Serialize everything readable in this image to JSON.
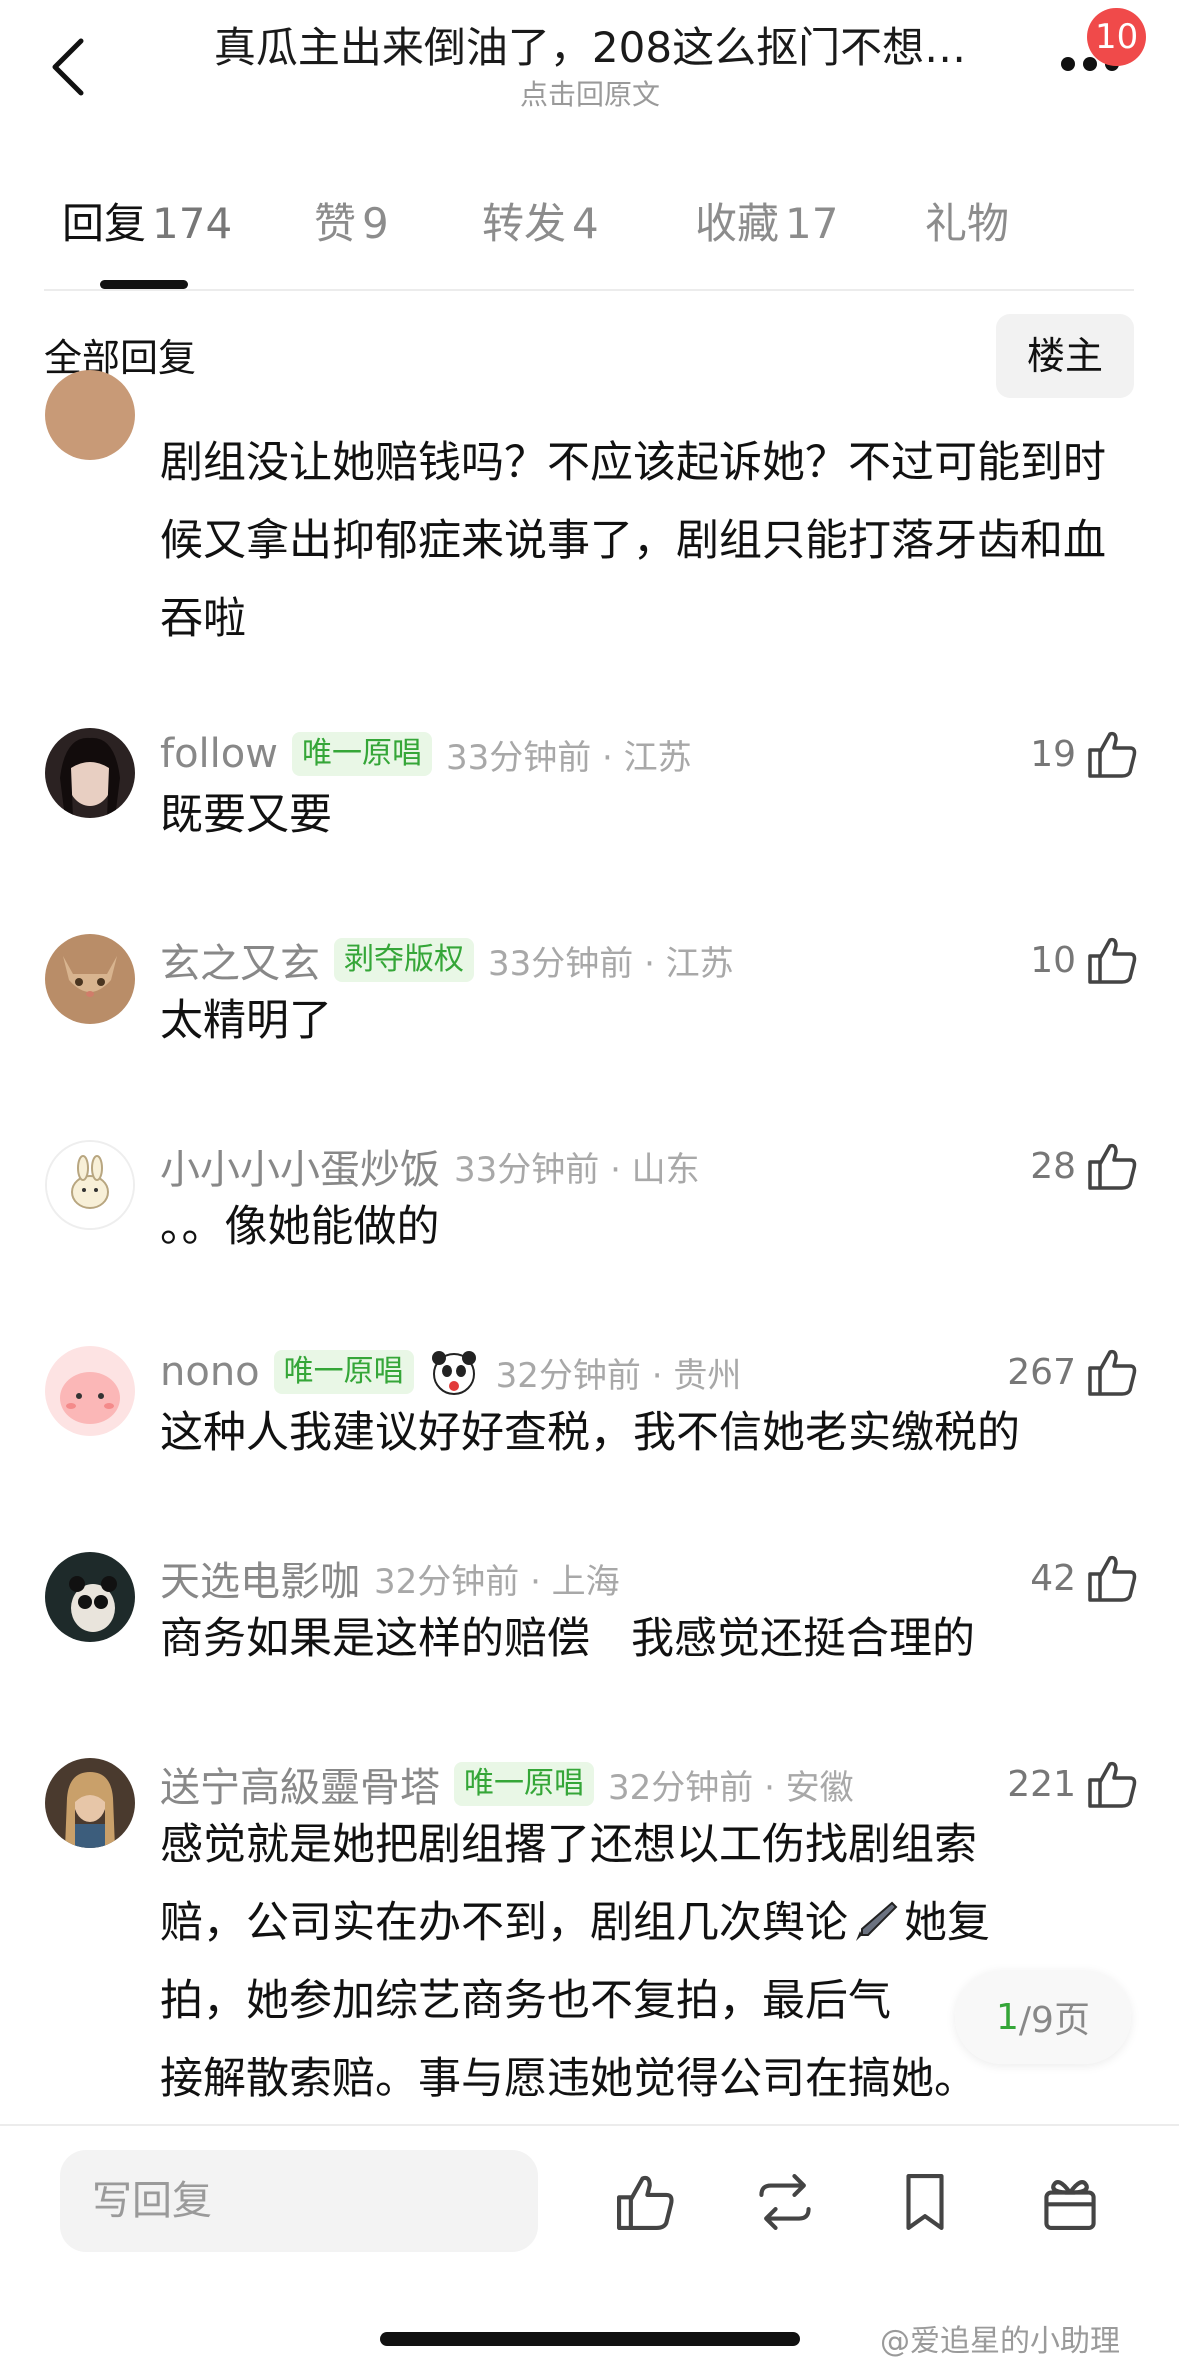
{
  "header": {
    "title": "真瓜主出来倒油了，208这么抠门不想…",
    "subtitle": "点击回原文",
    "notification_count": "10"
  },
  "tabs": [
    {
      "label": "回复",
      "count": "174",
      "active": true
    },
    {
      "label": "赞",
      "count": "9"
    },
    {
      "label": "转发",
      "count": "4"
    },
    {
      "label": "收藏",
      "count": "17"
    },
    {
      "label": "礼物",
      "count": ""
    }
  ],
  "filter": {
    "label": "全部回复",
    "host_button": "楼主"
  },
  "comments": [
    {
      "name": "",
      "badge": "",
      "time": "",
      "likes": "",
      "text": "剧组没让她赔钱吗？不应该起诉她？不过可能到时候又拿出抑郁症来说事了，剧组只能打落牙齿和血吞啦"
    },
    {
      "name": "follow",
      "badge": "唯一原唱",
      "time": "33分钟前 · 江苏",
      "likes": "19",
      "text": "既要又要"
    },
    {
      "name": "玄之又玄",
      "badge": "剥夺版权",
      "time": "33分钟前 · 江苏",
      "likes": "10",
      "text": "太精明了"
    },
    {
      "name": "小小小小蛋炒饭",
      "badge": "",
      "time": "33分钟前 · 山东",
      "likes": "28",
      "text": "。。像她能做的"
    },
    {
      "name": "nono",
      "badge": "唯一原唱",
      "time": "32分钟前 · 贵州",
      "likes": "267",
      "text": "这种人我建议好好查税，我不信她老实缴税的"
    },
    {
      "name": "天选电影咖",
      "badge": "",
      "time": "32分钟前 · 上海",
      "likes": "42",
      "text": "商务如果是这样的赔偿   我感觉还挺合理的"
    },
    {
      "name": "送宁高級靈骨塔",
      "badge": "唯一原唱",
      "time": "32分钟前 · 安徽",
      "likes": "221",
      "text_lines": [
        "感觉就是她把剧组撂了还想以工伤找剧组索",
        "赔，公司实在办不到，剧组几次舆论",
        "她复",
        "拍，她参加综艺商务也不复拍，最后气",
        "接解散索赔。事与愿违她觉得公司在搞她。"
      ]
    }
  ],
  "pagination": {
    "current": "1",
    "total": "/9页"
  },
  "bottom_bar": {
    "reply_placeholder": "写回复",
    "icons": [
      "like-icon",
      "repost-icon",
      "bookmark-icon",
      "gift-icon"
    ]
  },
  "watermark": "@爱追星的小助理",
  "colors": {
    "badge_green": "#35a638",
    "badge_bg": "#e9f7e6",
    "notif_red": "#f04a4a"
  }
}
